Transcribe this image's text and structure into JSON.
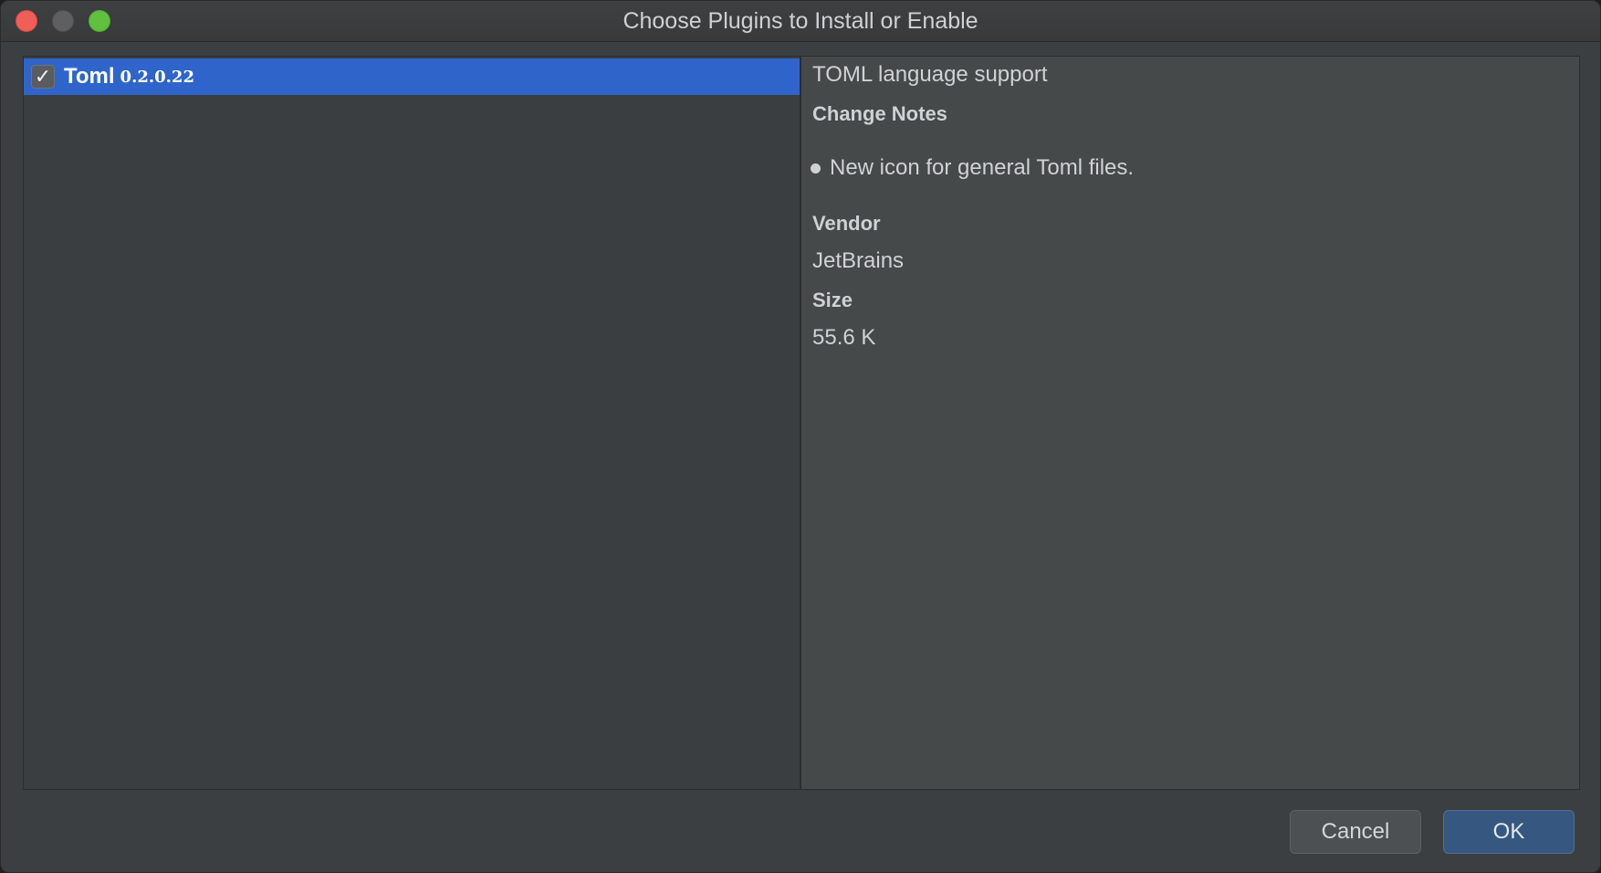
{
  "window": {
    "title": "Choose Plugins to Install or Enable"
  },
  "plugin_list": {
    "items": [
      {
        "name": "Toml",
        "version": "0.2.0.22",
        "checked": true,
        "checkmark": "✓"
      }
    ]
  },
  "details": {
    "description": "TOML language support",
    "change_notes_heading": "Change Notes",
    "change_notes": [
      "New icon for general Toml files."
    ],
    "vendor_heading": "Vendor",
    "vendor": "JetBrains",
    "size_heading": "Size",
    "size": "55.6 K"
  },
  "buttons": {
    "cancel_label": "Cancel",
    "ok_label": "OK"
  },
  "colors": {
    "selection": "#2f65ca",
    "window_bg": "#3c3f41",
    "ok_button": "#365880"
  }
}
